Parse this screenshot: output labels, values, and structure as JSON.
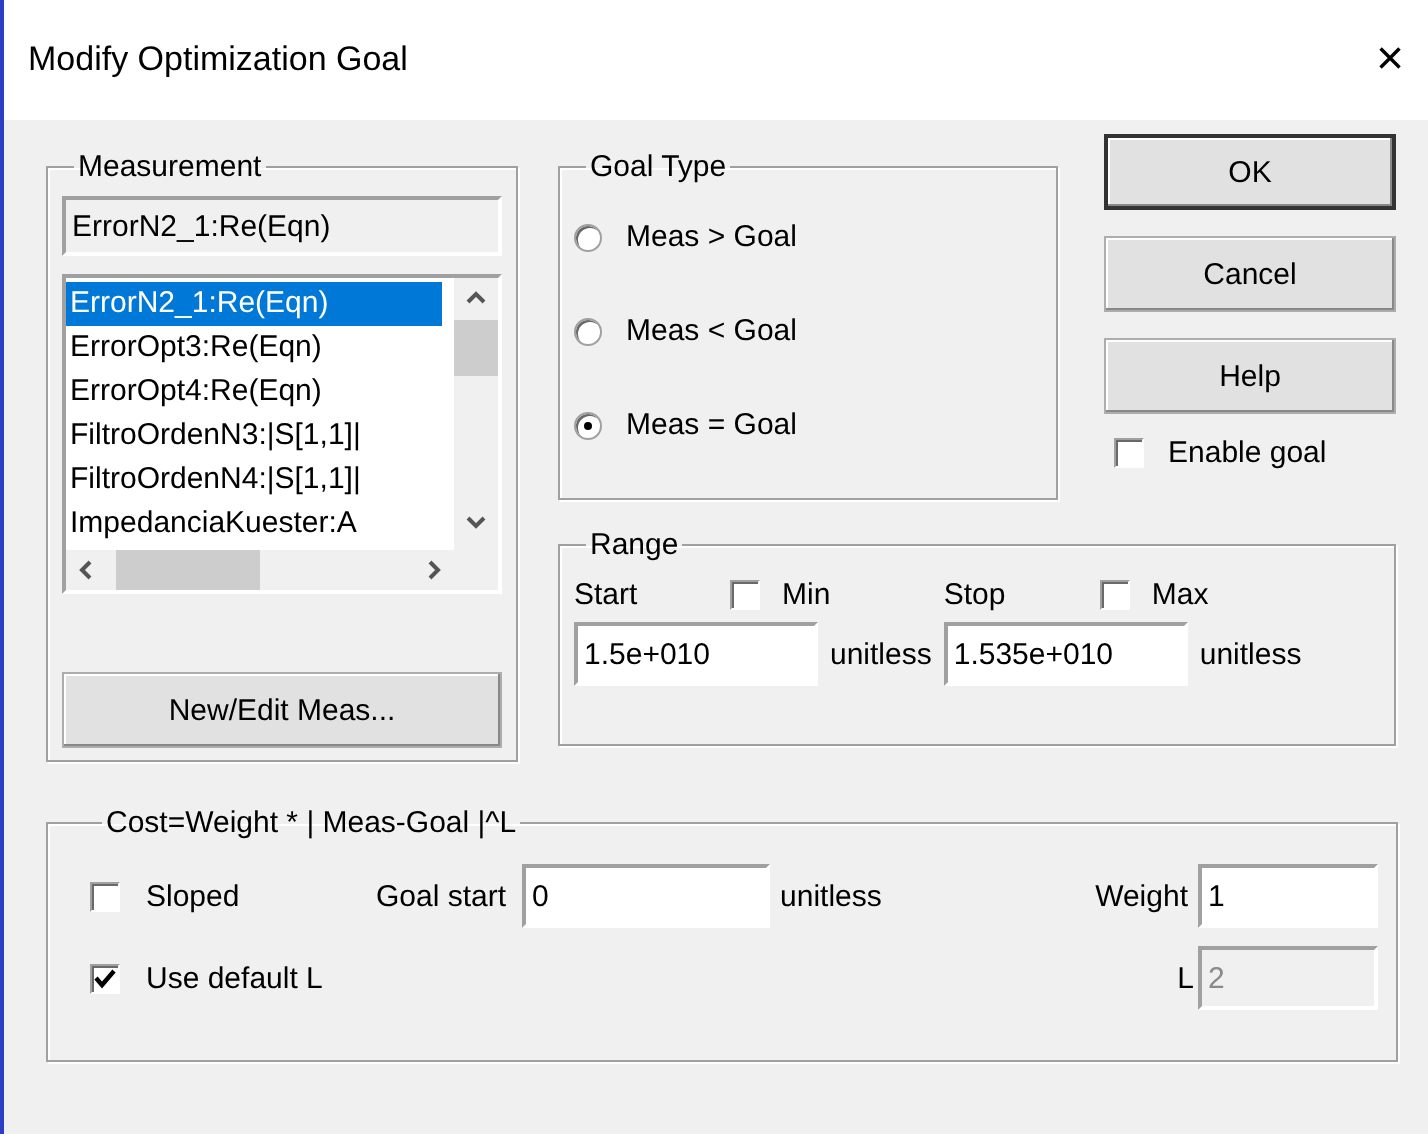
{
  "window": {
    "title": "Modify Optimization Goal",
    "close": "×"
  },
  "measurement": {
    "legend": "Measurement",
    "current": "ErrorN2_1:Re(Eqn)",
    "button": "New/Edit Meas...",
    "items": [
      {
        "label": "ErrorN2_1:Re(Eqn)",
        "selected": true
      },
      {
        "label": "ErrorOpt3:Re(Eqn)",
        "selected": false
      },
      {
        "label": "ErrorOpt4:Re(Eqn)",
        "selected": false
      },
      {
        "label": "FiltroOrdenN3:|S[1,1]|",
        "selected": false
      },
      {
        "label": "FiltroOrdenN4:|S[1,1]|",
        "selected": false
      },
      {
        "label": "ImpedanciaKuester:A",
        "selected": false
      }
    ]
  },
  "goal_type": {
    "legend": "Goal Type",
    "options": [
      {
        "label": "Meas > Goal",
        "selected": false
      },
      {
        "label": "Meas < Goal",
        "selected": false
      },
      {
        "label": "Meas = Goal",
        "selected": true
      }
    ]
  },
  "buttons": [
    {
      "label": "OK",
      "default": true
    },
    {
      "label": "Cancel",
      "default": false
    },
    {
      "label": "Help",
      "default": false
    }
  ],
  "enable_goal": {
    "label": "Enable goal",
    "checked": false
  },
  "range": {
    "legend": "Range",
    "start": {
      "label": "Start",
      "check_label": "Min",
      "checked": false,
      "value": "1.5e+010",
      "unit": "unitless"
    },
    "stop": {
      "label": "Stop",
      "check_label": "Max",
      "checked": false,
      "value": "1.535e+010",
      "unit": "unitless"
    }
  },
  "cost": {
    "legend": "Cost=Weight * | Meas-Goal |^L",
    "sloped": {
      "label": "Sloped",
      "checked": false
    },
    "use_default_l": {
      "label": "Use default L",
      "checked": true
    },
    "goal_start": {
      "label": "Goal start",
      "value": "0",
      "unit": "unitless"
    },
    "weight": {
      "label": "Weight",
      "value": "1"
    },
    "l": {
      "label": "L",
      "value": "2",
      "disabled": true
    }
  }
}
